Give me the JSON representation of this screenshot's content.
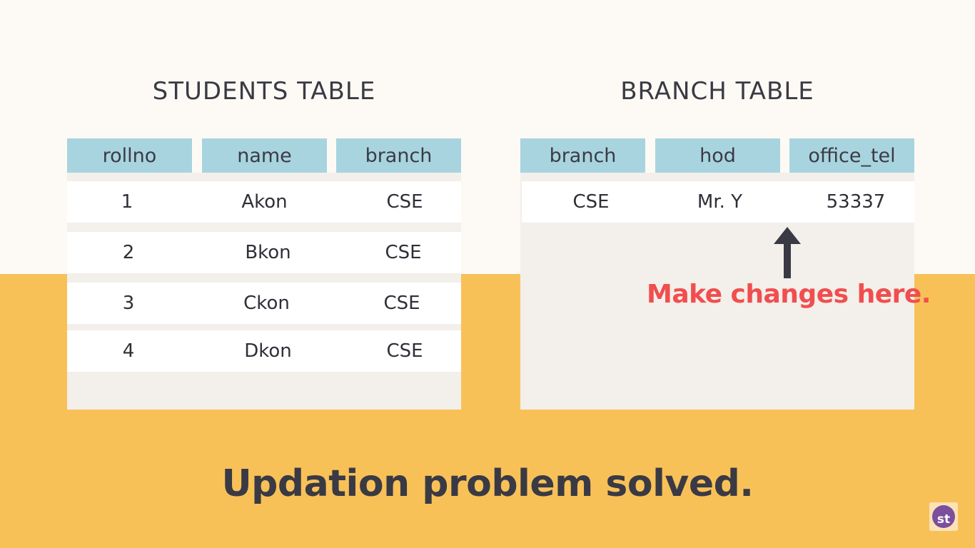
{
  "students": {
    "title": "STUDENTS TABLE",
    "headers": [
      "rollno",
      "name",
      "branch"
    ],
    "rows": [
      [
        "1",
        "Akon",
        "CSE"
      ],
      [
        "2",
        "Bkon",
        "CSE"
      ],
      [
        "3",
        "Ckon",
        "CSE"
      ],
      [
        "4",
        "Dkon",
        "CSE"
      ]
    ]
  },
  "branch": {
    "title": "BRANCH TABLE",
    "headers": [
      "branch",
      "hod",
      "office_tel"
    ],
    "rows": [
      [
        "CSE",
        "Mr. Y",
        "53337"
      ]
    ]
  },
  "annotation": "Make changes here.",
  "caption": "Updation problem solved.",
  "logo_text": "st",
  "colors": {
    "top_bg": "#fdfaf5",
    "bottom_bg": "#f8c158",
    "header_cell": "#a8d4df",
    "panel": "#f3efea",
    "annotation": "#f04e4f",
    "text_dark": "#3a3a44"
  },
  "icons": [
    "up-arrow-icon",
    "logo-icon"
  ]
}
